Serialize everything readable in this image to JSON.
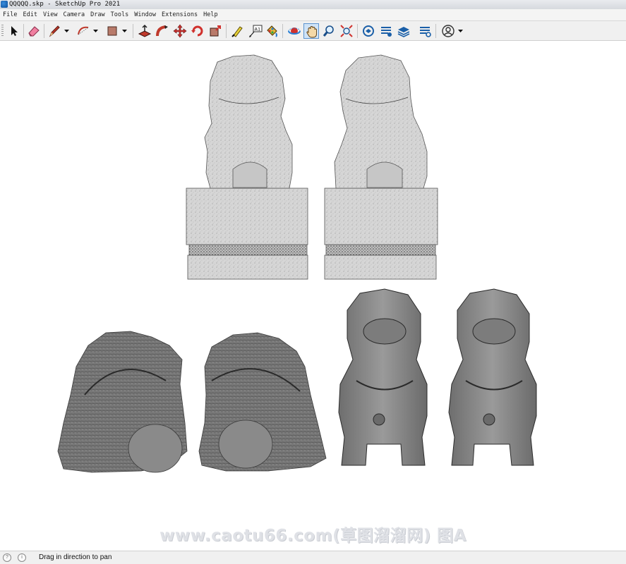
{
  "window": {
    "title": "QQQQQ.skp - SketchUp Pro 2021"
  },
  "menu": [
    "File",
    "Edit",
    "View",
    "Camera",
    "Draw",
    "Tools",
    "Window",
    "Extensions",
    "Help"
  ],
  "toolbar": {
    "tools": [
      {
        "name": "select-tool-button",
        "icon": "arrow-cursor-icon"
      },
      {
        "name": "eraser-tool-button",
        "icon": "eraser-icon"
      },
      {
        "name": "line-tool-button",
        "icon": "pencil-icon"
      },
      {
        "name": "arc-tool-button",
        "icon": "arc-icon"
      },
      {
        "name": "shape-tool-button",
        "icon": "rectangle-icon"
      },
      {
        "name": "push-pull-button",
        "icon": "push-pull-icon"
      },
      {
        "name": "follow-me-button",
        "icon": "follow-me-icon"
      },
      {
        "name": "move-tool-button",
        "icon": "move-icon"
      },
      {
        "name": "rotate-tool-button",
        "icon": "rotate-icon"
      },
      {
        "name": "scale-tool-button",
        "icon": "scale-icon"
      },
      {
        "name": "tape-measure-button",
        "icon": "tape-measure-icon"
      },
      {
        "name": "text-tool-button",
        "icon": "text-icon"
      },
      {
        "name": "paint-bucket-button",
        "icon": "paint-bucket-icon"
      },
      {
        "name": "orbit-tool-button",
        "icon": "orbit-icon"
      },
      {
        "name": "pan-tool-button",
        "icon": "hand-icon"
      },
      {
        "name": "zoom-tool-button",
        "icon": "magnifier-icon"
      },
      {
        "name": "zoom-extents-button",
        "icon": "zoom-extents-icon"
      },
      {
        "name": "3d-warehouse-button",
        "icon": "warehouse-icon"
      },
      {
        "name": "extension-warehouse-button",
        "icon": "extension-warehouse-icon"
      },
      {
        "name": "layout-button",
        "icon": "layers-icon"
      },
      {
        "name": "extension-manager-button",
        "icon": "extension-manager-icon"
      },
      {
        "name": "account-button",
        "icon": "user-icon"
      }
    ],
    "text_tool_glyph": "A1"
  },
  "watermark": "www.caotu66.com(草图溜溜网) 图A",
  "status": {
    "message": "Drag in direction to pan"
  },
  "colors": {
    "toolbar_bg": "#f0f0f0",
    "active_tool": "#cfe3f7",
    "viewport_bg": "#ffffff"
  }
}
